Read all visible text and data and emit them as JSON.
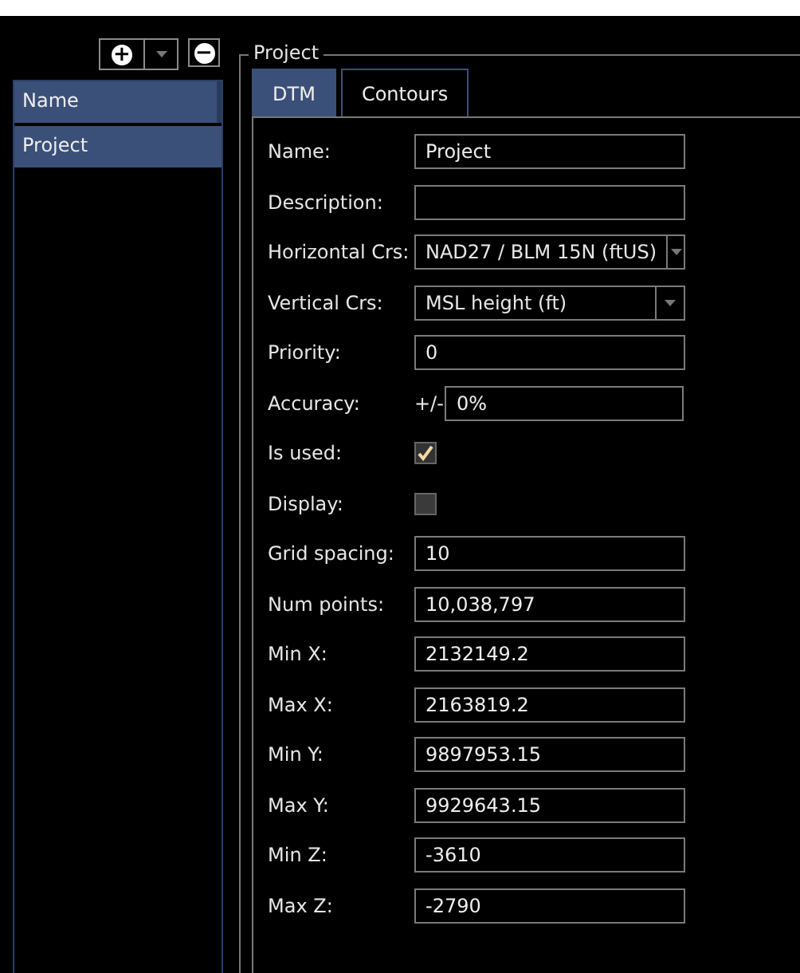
{
  "toolbar": {
    "add_button": "+",
    "remove_button": "−"
  },
  "list": {
    "header": "Name",
    "items": [
      {
        "label": "Project",
        "selected": true
      }
    ]
  },
  "group": {
    "title": "Project"
  },
  "tabs": [
    {
      "label": "DTM",
      "selected": true
    },
    {
      "label": "Contours",
      "selected": false
    }
  ],
  "fields": [
    {
      "kind": "text",
      "label": "Name:",
      "value": "Project"
    },
    {
      "kind": "text",
      "label": "Description:"
    },
    {
      "kind": "combo",
      "label": "Horizontal Crs:",
      "value": "NAD27 / BLM 15N (ftUS)"
    },
    {
      "kind": "combo",
      "label": "Vertical Crs:",
      "value": "MSL height (ft)"
    },
    {
      "kind": "text",
      "label": "Priority:",
      "value": "0"
    },
    {
      "kind": "prefixed",
      "label": "Accuracy:",
      "prefix": "+/-",
      "value": "0%"
    },
    {
      "kind": "checkbox",
      "label": "Is used:",
      "checked": true
    },
    {
      "kind": "checkbox",
      "label": "Display:",
      "checked": false
    },
    {
      "kind": "text",
      "label": "Grid spacing:",
      "value": "10"
    },
    {
      "kind": "text",
      "label": "Num points:",
      "value": "10,038,797"
    },
    {
      "kind": "text",
      "label": "Min X:",
      "value": "2132149.2"
    },
    {
      "kind": "text",
      "label": "Max X:",
      "value": "2163819.2"
    },
    {
      "kind": "text",
      "label": "Min Y:",
      "value": "9897953.15"
    },
    {
      "kind": "text",
      "label": "Max Y:",
      "value": "9929643.15"
    },
    {
      "kind": "text",
      "label": "Min Z:",
      "value": "-3610"
    },
    {
      "kind": "text",
      "label": "Max Z:",
      "value": "-2790"
    }
  ]
}
